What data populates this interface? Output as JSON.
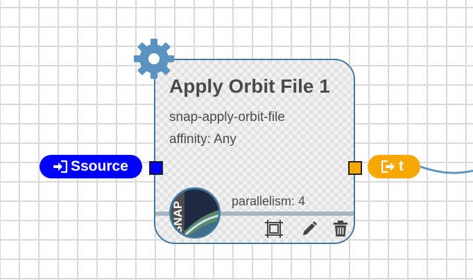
{
  "node": {
    "title": "Apply Orbit File 1",
    "image": "snap-apply-orbit-file",
    "affinity": "affinity: Any",
    "parallelism": "parallelism: 4",
    "avatar_text": "SNAP",
    "tools": {
      "frame_icon": "frame-icon",
      "edit_icon": "pencil-icon",
      "delete_icon": "trash-icon"
    }
  },
  "input": {
    "label": "Ssource",
    "icon": "sign-in-icon",
    "color": "#0000ff"
  },
  "output": {
    "label": "t",
    "icon": "sign-out-icon",
    "color": "#f6a800"
  },
  "colors": {
    "node_border": "#44799f",
    "gear": "#5b93c0",
    "edge": "#5b93c0"
  }
}
